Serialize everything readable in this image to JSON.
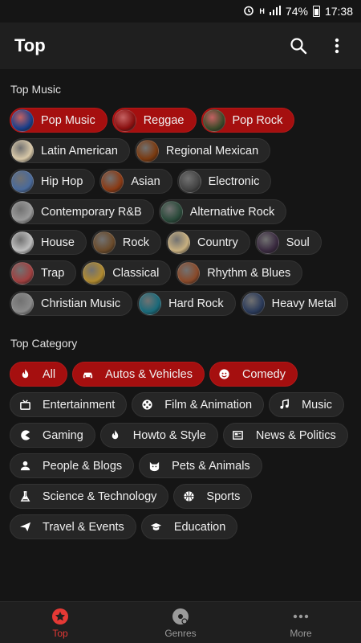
{
  "status": {
    "battery": "74%",
    "time": "17:38"
  },
  "appbar": {
    "title": "Top"
  },
  "top_music": {
    "title": "Top Music",
    "items": [
      {
        "label": "Pop Music",
        "active": true,
        "color": "#1a3f8a"
      },
      {
        "label": "Reggae",
        "active": true,
        "color": "#8a1010"
      },
      {
        "label": "Pop Rock",
        "active": true,
        "color": "#3d4a2a"
      },
      {
        "label": "Latin American",
        "active": false,
        "color": "#d8c8a8"
      },
      {
        "label": "Regional Mexican",
        "active": false,
        "color": "#7a3a10"
      },
      {
        "label": "Hip Hop",
        "active": false,
        "color": "#4a6a9a"
      },
      {
        "label": "Asian",
        "active": false,
        "color": "#8a3a14"
      },
      {
        "label": "Electronic",
        "active": false,
        "color": "#444444"
      },
      {
        "label": "Contemporary R&B",
        "active": false,
        "color": "#9a9a9a"
      },
      {
        "label": "Alternative Rock",
        "active": false,
        "color": "#2a4a3a"
      },
      {
        "label": "House",
        "active": false,
        "color": "#bdbdbd"
      },
      {
        "label": "Rock",
        "active": false,
        "color": "#6a4a2a"
      },
      {
        "label": "Country",
        "active": false,
        "color": "#c8b080"
      },
      {
        "label": "Soul",
        "active": false,
        "color": "#3a2a40"
      },
      {
        "label": "Trap",
        "active": false,
        "color": "#a04040"
      },
      {
        "label": "Classical",
        "active": false,
        "color": "#b08a30"
      },
      {
        "label": "Rhythm & Blues",
        "active": false,
        "color": "#8a4a2a"
      },
      {
        "label": "Christian Music",
        "active": false,
        "color": "#8a8a8a"
      },
      {
        "label": "Hard Rock",
        "active": false,
        "color": "#1a6a7a"
      },
      {
        "label": "Heavy Metal",
        "active": false,
        "color": "#2a3a5a"
      }
    ]
  },
  "top_category": {
    "title": "Top Category",
    "items": [
      {
        "label": "All",
        "active": true,
        "icon": "fire-icon"
      },
      {
        "label": "Autos & Vehicles",
        "active": true,
        "icon": "car-icon"
      },
      {
        "label": "Comedy",
        "active": true,
        "icon": "smiley-icon"
      },
      {
        "label": "Entertainment",
        "active": false,
        "icon": "tv-icon"
      },
      {
        "label": "Film & Animation",
        "active": false,
        "icon": "film-reel-icon"
      },
      {
        "label": "Music",
        "active": false,
        "icon": "music-note-icon"
      },
      {
        "label": "Gaming",
        "active": false,
        "icon": "pacman-icon"
      },
      {
        "label": "Howto & Style",
        "active": false,
        "icon": "flame-icon"
      },
      {
        "label": "News & Politics",
        "active": false,
        "icon": "newspaper-icon"
      },
      {
        "label": "People & Blogs",
        "active": false,
        "icon": "person-icon"
      },
      {
        "label": "Pets & Animals",
        "active": false,
        "icon": "cat-icon"
      },
      {
        "label": "Science & Technology",
        "active": false,
        "icon": "flask-icon"
      },
      {
        "label": "Sports",
        "active": false,
        "icon": "basketball-icon"
      },
      {
        "label": "Travel & Events",
        "active": false,
        "icon": "paper-plane-icon"
      },
      {
        "label": "Education",
        "active": false,
        "icon": "graduation-cap-icon"
      }
    ]
  },
  "bottom_nav": [
    {
      "label": "Top",
      "icon": "star-icon",
      "active": true
    },
    {
      "label": "Genres",
      "icon": "disc-icon",
      "active": false
    },
    {
      "label": "More",
      "icon": "more-horizontal-icon",
      "active": false
    }
  ],
  "colors": {
    "accent": "#a50f0f",
    "nav_active": "#e53935",
    "background": "#151515",
    "chip": "#262626"
  }
}
